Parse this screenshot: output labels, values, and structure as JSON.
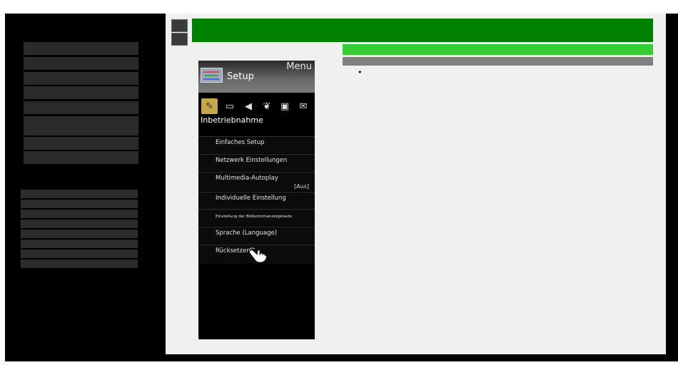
{
  "menu": {
    "header_label": "Menu",
    "title": "Setup",
    "category": "Inbetriebnahme",
    "items": [
      {
        "label": "Einfaches Setup"
      },
      {
        "label": "Netzwerk Einstellungen"
      },
      {
        "label": "Multimedia-Autoplay",
        "value": "[Aus]"
      },
      {
        "label": "Individuelle Einstellung"
      },
      {
        "label": "Einstellung der Bildschirmanzeigetaste"
      },
      {
        "label": "Sprache (Language)"
      },
      {
        "label": "Rücksetzen"
      }
    ],
    "icons": [
      "wrench-icon",
      "picture-icon",
      "speaker-icon",
      "leaf-icon",
      "toolbox-icon",
      "mail-icon"
    ]
  },
  "content": {
    "bullet": "•"
  },
  "colors": {
    "top_bar": "#008000",
    "sub_bar": "#33cc33",
    "gray_bar": "#808080",
    "highlight": "#c8a64a"
  }
}
